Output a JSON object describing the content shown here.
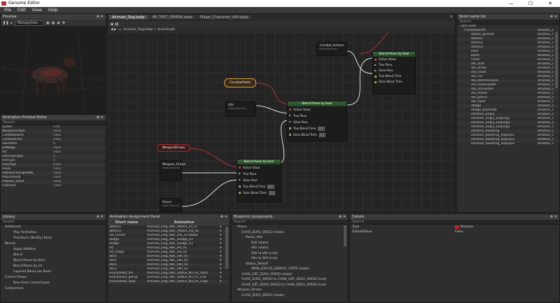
{
  "window": {
    "title": "Genome Editor"
  },
  "menu": [
    "File",
    "Edit",
    "View",
    "Help"
  ],
  "preview": {
    "title": "Preview",
    "dropdown": "Perspective"
  },
  "anim_preview": {
    "title": "Animation Preview Editor",
    "search": "Search",
    "rows": [
      [
        "Speed",
        "0.00"
      ],
      [
        "WeaponDrawn",
        "False"
      ],
      [
        "CombatStarts",
        "False"
      ],
      [
        "CombatEnds",
        "False"
      ],
      [
        "StandIdle",
        "0"
      ],
      [
        "HitMagic",
        "False"
      ],
      [
        "Hit",
        "False"
      ],
      [
        "InterruptType",
        "0"
      ],
      [
        "UseType",
        "0"
      ],
      [
        "Interrupt",
        "False"
      ],
      [
        "Aside",
        "False"
      ],
      [
        "IsNewOnRangedAtk",
        "False"
      ],
      [
        "PrepareSkill",
        "False"
      ],
      [
        "Prepare_Done",
        "False"
      ],
      [
        "CastSkill",
        "False"
      ]
    ]
  },
  "graph": {
    "tabs": [
      "Animals_Dog.babp",
      "BP_TEST_DEMON.babp",
      "Player_Character_v04.babp"
    ],
    "breadcrumb": [
      "Animals_Dog.babp",
      "AnimGraph"
    ],
    "nodes": {
      "combat_actions": "Combat_Actions",
      "combat_sub": "State Machine",
      "blend1": "Blend Poses by bool",
      "combatstate": "CombatState",
      "idle": "Idle",
      "idle_sub": "State Machine",
      "blend2": "Blend Poses by bool",
      "weapondrawn_var": "WeaponDrawn",
      "weapon_drawn": "Weapon_Drawn",
      "wd_sub": "State Machine",
      "blend3": "Blend Poses by bool",
      "peace": "Peace",
      "peace_sub": "State Machine"
    },
    "pins": {
      "active": "Active Value",
      "true_pose": "True Pose",
      "false_pose": "False Pose",
      "true_blend": "True Blend Time",
      "false_blend": "False Blend Time",
      "blend_val": "0.1"
    }
  },
  "short_names": {
    "title": "Short name list",
    "search": "Search",
    "items": [
      [
        "Last used",
        ""
      ],
      [
        "CrossBow(49)",
        "emotion_c"
      ],
      [
        "attack_ground",
        "emotion_c"
      ],
      [
        "attack1",
        "emotion_c"
      ],
      [
        "attack2",
        "emotion_c"
      ],
      [
        "attack3",
        "emotion_c"
      ],
      [
        "bark",
        "emotion_c"
      ],
      [
        "block",
        "emotion_c"
      ],
      [
        "cover",
        "emotion_c"
      ],
      [
        "die_acid",
        "emotion_c"
      ],
      [
        "die_arrow",
        "emotion_c"
      ],
      [
        "die_crush",
        "emotion_c"
      ],
      [
        "die_cut",
        "emotion_c"
      ],
      [
        "die_electrocution",
        "emotion_c"
      ],
      [
        "die_frozenwater",
        "emotion_c"
      ],
      [
        "die_incinerate",
        "emotion_c"
      ],
      [
        "die_melee",
        "emotion_c"
      ],
      [
        "die_pierce",
        "emotion_c"
      ],
      [
        "die_slash",
        "emotion_c"
      ],
      [
        "dodge",
        "emotion_c"
      ],
      [
        "dodge_backstab",
        "emotion_c"
      ],
      [
        "emotion_angry",
        "emotion_c"
      ],
      [
        "emotion_angry_looping1",
        "emotion_c"
      ],
      [
        "emotion_angry_looping2",
        "emotion_c"
      ],
      [
        "emotion_angry_looping3",
        "emotion_c"
      ],
      [
        "emotion_boasting",
        "emotion_c"
      ],
      [
        "emotion_boasting_loopinp1",
        "emotion_c"
      ],
      [
        "emotion_boasting_loopinp2",
        "emotion_c"
      ],
      [
        "emotion_boasting_loopinp3",
        "emotion_c"
      ]
    ]
  },
  "library": {
    "title": "Library",
    "search": "Search",
    "items": [
      "Additional",
      "Play Animation",
      "Transform (Modify) Bone",
      "Blends",
      "Apply Additive",
      "Blend",
      "Blend Poses by bool",
      "Blend Poses by int",
      "Layered Blend per Bone",
      "Cached Poses",
      "New Save cached pose",
      "Comparison"
    ]
  },
  "assignment": {
    "title": "Animation Assignment Panel",
    "col1": "Short name",
    "col2": "Animation",
    "rows": [
      [
        "attack1",
        "Animals_Dog_ABC_Attack_01_O"
      ],
      [
        "attack2",
        "Animals_Dog_ABC_Attack_Vill_01"
      ],
      [
        "die_melee",
        "Animals_Dog_ABC_Die_STUBBSE"
      ],
      [
        "dodge",
        "Animals_Dog_ABC_Dodge_01"
      ],
      [
        "dodge",
        "Animals_Dog_ABC_Dodge_01"
      ],
      [
        "hit",
        "Animals_Dog_ABC_Hit_01"
      ],
      [
        "hit_magic",
        "Animals_Dog_ABC_Hit_02"
      ],
      [
        "idle1",
        "Animals_Dog_ABC_Idle_01"
      ],
      [
        "idle1",
        "Animals_Dog_ABC_Idle_01"
      ],
      [
        "idle2",
        "Animals_Dog_ABC_Idle_01"
      ],
      [
        "idle3",
        "Animals_Dog_ABC_Idle_01"
      ],
      [
        "knockdown_hit",
        "Animals_Dog_ABC_Status_KO_01_Start"
      ],
      [
        "knockdown_getup",
        "Animals_Dog_ABC_Status_KO_01_End"
      ],
      [
        "knockdown_loop",
        "Animals_Dog_ABC_Status_KO_01_Loop"
      ]
    ]
  },
  "blueprint": {
    "title": "Blueprint components",
    "search": "Search",
    "items": [
      "Peace",
      "CHAR_ZERO_SPEED (state)",
      "Peace_Idle",
      "Still (state)",
      "Idle (state)",
      "Still to Idle (rule)",
      "Idle to Still (rule)",
      "Status_Debuff",
      "MAIN_STATUS_DEBUFF_STATE (state)",
      "CHAR_GRT_ZERO_SPEED (state)",
      "CHAR_ZERO_SPEED to CHAR_GRT_ZERO_SPEED (rule)",
      "CHAR_GRT_ZERO_SPEED to CHAR_ZERO_SPEED (rule)",
      "Weapon_Drawn",
      "CHAR_ZERO_SPEED (state)"
    ]
  },
  "details": {
    "title": "Details",
    "search": "Search",
    "type_label": "Type",
    "type_val": "Boolean",
    "default_label": "DefaultValue",
    "default_val": "False"
  }
}
